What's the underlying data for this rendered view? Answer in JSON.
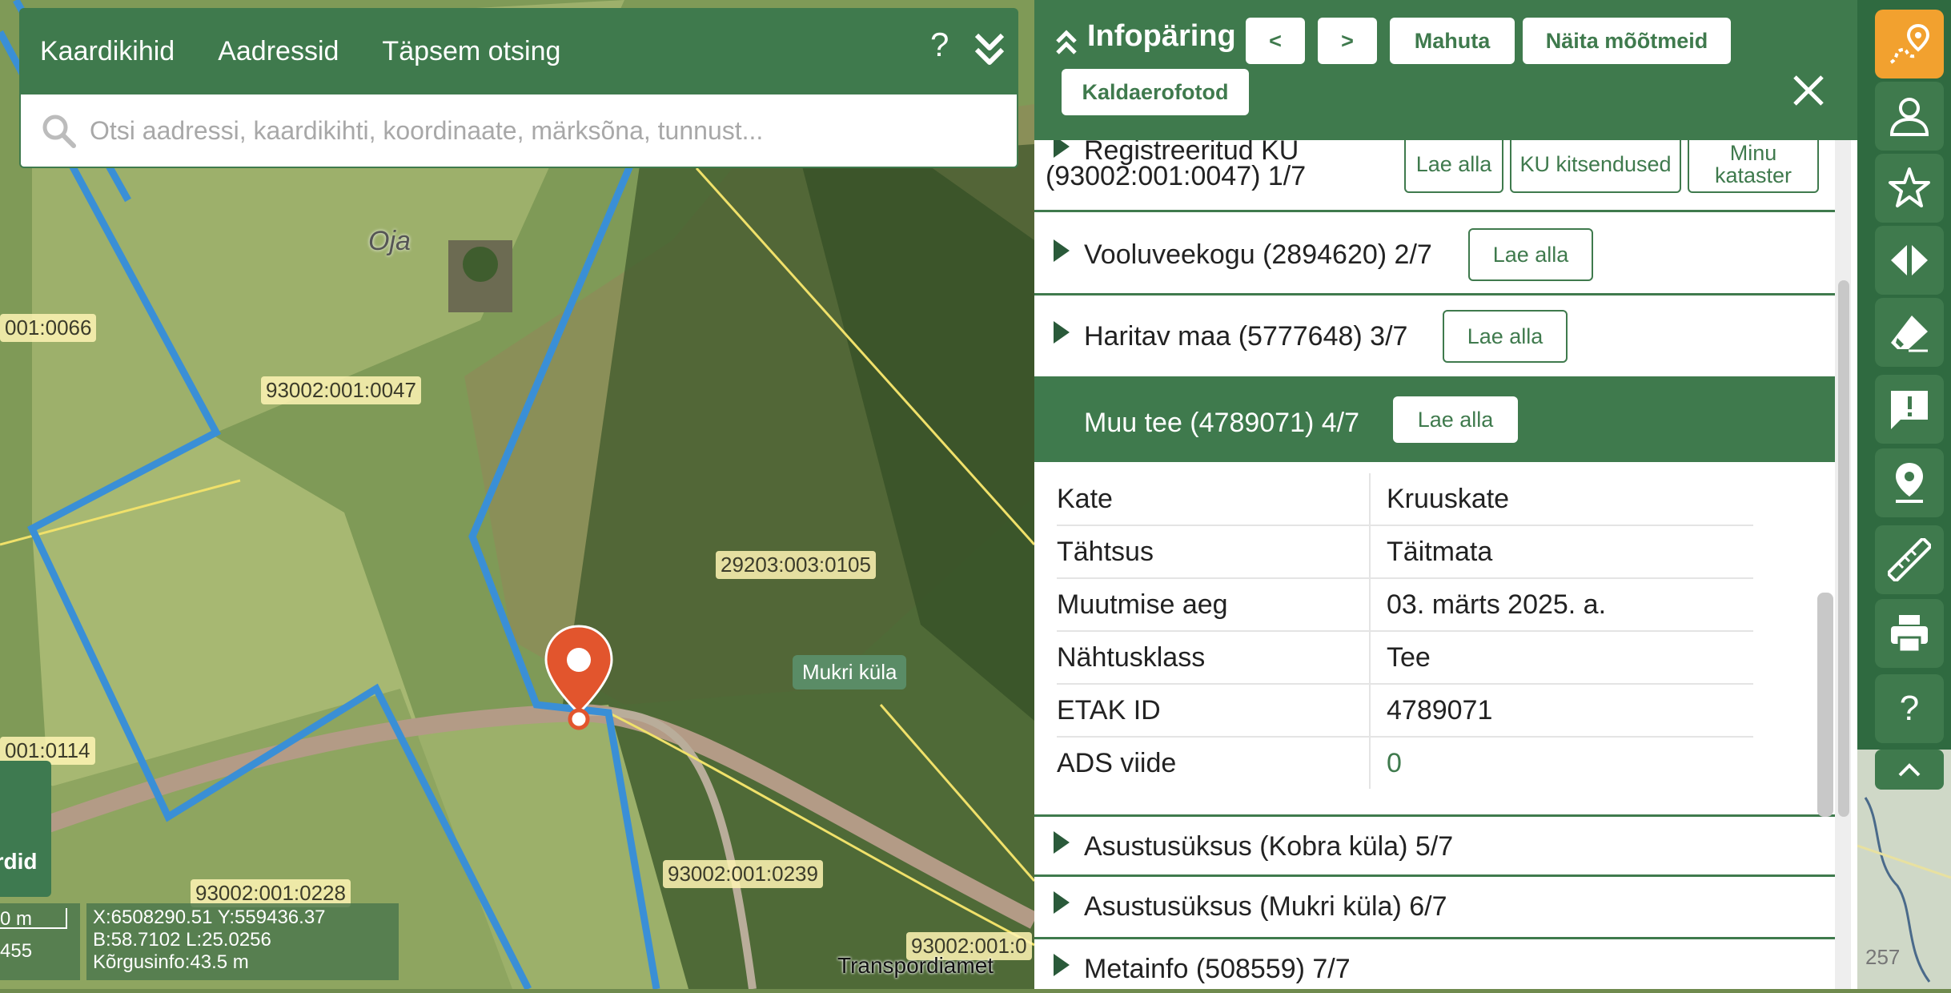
{
  "search": {
    "tabs": [
      "Kaardikihid",
      "Aadressid",
      "Täpsem otsing"
    ],
    "help_icon": "?",
    "collapse_icon": "double-chevron-down",
    "placeholder": "Otsi aadressi, kaardikihti, koordinaate, märksõna, tunnust..."
  },
  "map": {
    "parcel_labels": [
      "001:0066",
      "93002:001:0047",
      "29203:003:0105",
      "001:0114",
      "93002:001:0228",
      "93002:001:0239",
      "93002:001:0"
    ],
    "place_label": "Oja",
    "village_badge": "Mukri küla",
    "attribution": "Transpordiamet",
    "scale": {
      "label": "0 m",
      "number": "455"
    },
    "coords": {
      "line1": "X:6508290.51 Y:559436.37",
      "line2": "B:58.7102 L:25.0256",
      "line3": "Kõrgusinfo:43.5 m"
    },
    "layers_button": "ardid",
    "minimap_number": "257",
    "colors": {
      "parcel_border": "#3a8fd6",
      "marker": "#e2552d"
    }
  },
  "info": {
    "title": "Infopäring",
    "buttons": {
      "prev": "<",
      "next": ">",
      "fit": "Mahuta",
      "show_measurements": "Näita mõõtmeid",
      "aerial": "Kaldaerofotod"
    },
    "sections": [
      {
        "title_line1": "Registreeritud KU",
        "title_line2": "(93002:001:0047) 1/7",
        "btn1": "Lae alla",
        "btn2": "KU kitsendused",
        "btn3": "Minu kataster"
      },
      {
        "title": "Vooluveekogu (2894620) 2/7",
        "btn": "Lae alla"
      },
      {
        "title": "Haritav maa (5777648) 3/7",
        "btn": "Lae alla"
      },
      {
        "title": "Muu tee (4789071) 4/7",
        "btn": "Lae alla"
      },
      {
        "title": "Asustusüksus (Kobra küla) 5/7"
      },
      {
        "title": "Asustusüksus (Mukri küla) 6/7"
      },
      {
        "title": "Metainfo (508559) 7/7"
      }
    ],
    "attributes": [
      {
        "key": "Kate",
        "value": "Kruuskate"
      },
      {
        "key": "Tähtsus",
        "value": "Täitmata"
      },
      {
        "key": "Muutmise aeg",
        "value": "03. märts 2025. a."
      },
      {
        "key": "Nähtusklass",
        "value": "Tee"
      },
      {
        "key": "ETAK ID",
        "value": "4789071"
      },
      {
        "key": "ADS viide",
        "value": "0"
      }
    ],
    "colors": {
      "primary": "#3f7a4d"
    }
  },
  "toolbar": {
    "items": [
      "map-query-icon",
      "user-icon",
      "star-icon",
      "split-arrows-icon",
      "eraser-icon",
      "feedback-icon",
      "location-pin-icon",
      "ruler-icon",
      "print-icon",
      "help-icon",
      "chevron-up-icon"
    ],
    "help_glyph": "?",
    "colors": {
      "active": "#f2a12f"
    }
  }
}
